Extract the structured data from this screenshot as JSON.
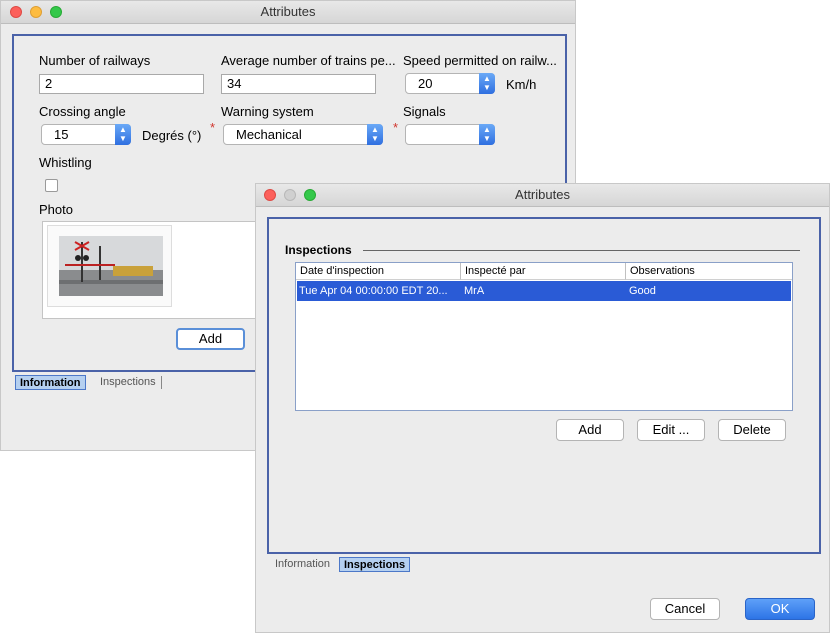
{
  "window1": {
    "title": "Attributes",
    "fields": {
      "num_railways_label": "Number of railways",
      "num_railways_value": "2",
      "avg_trains_label": "Average number of trains pe...",
      "avg_trains_value": "34",
      "speed_label": "Speed permitted on railw...",
      "speed_value": "20",
      "speed_unit": "Km/h",
      "crossing_angle_label": "Crossing angle",
      "crossing_angle_value": "15",
      "crossing_angle_unit": "Degrés (°)",
      "warning_label": "Warning system",
      "warning_value": "Mechanical",
      "signals_label": "Signals",
      "signals_value": "",
      "whistling_label": "Whistling",
      "photo_label": "Photo",
      "required_mark": "*"
    },
    "add_label": "Add",
    "tabs": [
      "Information",
      "Inspections"
    ]
  },
  "window2": {
    "title": "Attributes",
    "section_title": "Inspections",
    "columns": [
      "Date d'inspection",
      "Inspecté par",
      "Observations"
    ],
    "rows": [
      [
        "Tue Apr 04 00:00:00 EDT 20...",
        "MrA",
        "Good"
      ]
    ],
    "buttons": {
      "add": "Add",
      "edit": "Edit ...",
      "delete": "Delete"
    },
    "tabs": [
      "Information",
      "Inspections"
    ],
    "cancel_label": "Cancel",
    "ok_label": "OK"
  },
  "colors": {
    "accent": "#4a62a8",
    "selection": "#2a5bd6",
    "required": "#d0342c"
  }
}
